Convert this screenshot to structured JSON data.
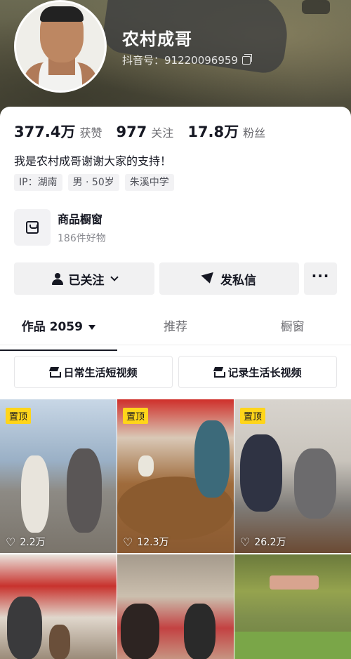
{
  "profile": {
    "name": "农村成哥",
    "douyin_id": "抖音号：91220096959"
  },
  "stats": [
    {
      "value": "377.4万",
      "label": "获赞"
    },
    {
      "value": "977",
      "label": "关注"
    },
    {
      "value": "17.8万",
      "label": "粉丝"
    }
  ],
  "bio": "我是农村成哥谢谢大家的支持！",
  "tags": [
    "IP：湖南",
    "男 · 50岁",
    "朱溪中学"
  ],
  "shop": {
    "title": "商品橱窗",
    "subtitle": "186件好物"
  },
  "actions": {
    "follow": "已关注",
    "message": "发私信",
    "more": "···"
  },
  "tabs": [
    {
      "label": "作品 2059",
      "active": true
    },
    {
      "label": "推荐",
      "active": false
    },
    {
      "label": "橱窗",
      "active": false
    }
  ],
  "collections": [
    "日常生活短视频",
    "记录生活长视频"
  ],
  "videos": [
    {
      "pinned": "置顶",
      "likes": "2.2万"
    },
    {
      "pinned": "置顶",
      "likes": "12.3万"
    },
    {
      "pinned": "置顶",
      "likes": "26.2万"
    },
    {
      "pinned": "",
      "likes": ""
    },
    {
      "pinned": "",
      "likes": ""
    },
    {
      "pinned": "",
      "likes": ""
    }
  ]
}
